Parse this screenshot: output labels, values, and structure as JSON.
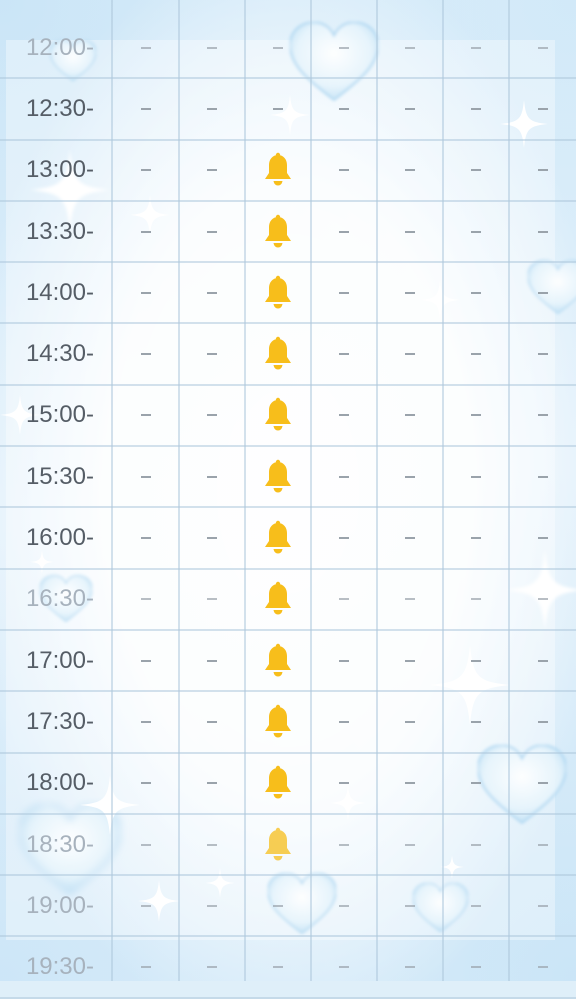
{
  "schedule": {
    "rows": [
      {
        "time": "12:00-",
        "cells": [
          "-",
          "-",
          "-",
          "-",
          "-",
          "-",
          "-"
        ]
      },
      {
        "time": "12:30-",
        "cells": [
          "-",
          "-",
          "-",
          "-",
          "-",
          "-",
          "-"
        ]
      },
      {
        "time": "13:00-",
        "cells": [
          "-",
          "-",
          "bell",
          "-",
          "-",
          "-",
          "-"
        ]
      },
      {
        "time": "13:30-",
        "cells": [
          "-",
          "-",
          "bell",
          "-",
          "-",
          "-",
          "-"
        ]
      },
      {
        "time": "14:00-",
        "cells": [
          "-",
          "-",
          "bell",
          "-",
          "-",
          "-",
          "-"
        ]
      },
      {
        "time": "14:30-",
        "cells": [
          "-",
          "-",
          "bell",
          "-",
          "-",
          "-",
          "-"
        ]
      },
      {
        "time": "15:00-",
        "cells": [
          "-",
          "-",
          "bell",
          "-",
          "-",
          "-",
          "-"
        ]
      },
      {
        "time": "15:30-",
        "cells": [
          "-",
          "-",
          "bell",
          "-",
          "-",
          "-",
          "-"
        ]
      },
      {
        "time": "16:00-",
        "cells": [
          "-",
          "-",
          "bell",
          "-",
          "-",
          "-",
          "-"
        ]
      },
      {
        "time": "16:30-",
        "cells": [
          "-",
          "-",
          "bell",
          "-",
          "-",
          "-",
          "-"
        ]
      },
      {
        "time": "17:00-",
        "cells": [
          "-",
          "-",
          "bell",
          "-",
          "-",
          "-",
          "-"
        ]
      },
      {
        "time": "17:30-",
        "cells": [
          "-",
          "-",
          "bell",
          "-",
          "-",
          "-",
          "-"
        ]
      },
      {
        "time": "18:00-",
        "cells": [
          "-",
          "-",
          "bell",
          "-",
          "-",
          "-",
          "-"
        ]
      },
      {
        "time": "18:30-",
        "cells": [
          "-",
          "-",
          "bell",
          "-",
          "-",
          "-",
          "-"
        ]
      },
      {
        "time": "19:00-",
        "cells": [
          "-",
          "-",
          "-",
          "-",
          "-",
          "-",
          "-"
        ]
      },
      {
        "time": "19:30-",
        "cells": [
          "-",
          "-",
          "-",
          "-",
          "-",
          "-",
          "-"
        ]
      }
    ]
  },
  "icons": {
    "available": "bell-icon",
    "unavailable": "dash-icon"
  },
  "colors": {
    "bell": "#f7be1b",
    "dash": "#9aa3ab",
    "grid_line": "#afc8dc",
    "time_text": "#555d66",
    "background": "#e3f1fb"
  }
}
